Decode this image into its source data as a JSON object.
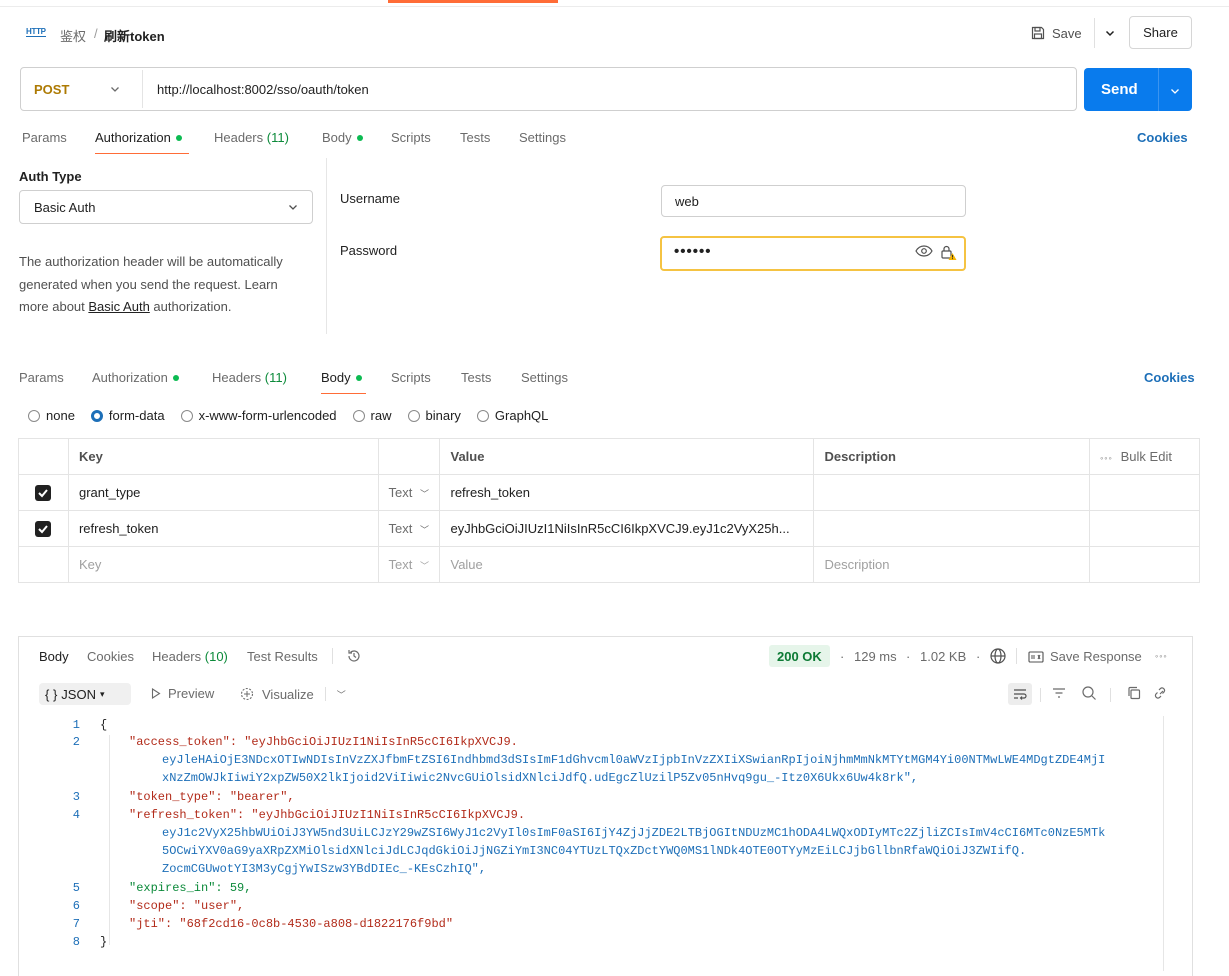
{
  "breadcrumb": {
    "collection": "鉴权",
    "separator": "/",
    "request": "刷新token"
  },
  "header": {
    "save_label": "Save",
    "share_label": "Share",
    "http_badge": "HTTP"
  },
  "request": {
    "method": "POST",
    "url": "http://localhost:8002/sso/oauth/token",
    "send_label": "Send"
  },
  "tabs": {
    "params": "Params",
    "authorization": "Authorization",
    "headers": "Headers",
    "headers_count": "(11)",
    "body": "Body",
    "scripts": "Scripts",
    "tests": "Tests",
    "settings": "Settings",
    "cookies": "Cookies"
  },
  "auth": {
    "type_label": "Auth Type",
    "type_value": "Basic Auth",
    "desc_pre": "The authorization header will be automatically generated when you send the request. Learn more about ",
    "desc_link": "Basic Auth",
    "desc_post": " authorization.",
    "username_label": "Username",
    "username_value": "web",
    "password_label": "Password",
    "password_value": "••••••"
  },
  "body_types": [
    "none",
    "form-data",
    "x-www-form-urlencoded",
    "raw",
    "binary",
    "GraphQL"
  ],
  "body_selected": "form-data",
  "table": {
    "headers": {
      "key": "Key",
      "value": "Value",
      "description": "Description",
      "bulk_edit": "Bulk Edit"
    },
    "rows": [
      {
        "key": "grant_type",
        "type": "Text",
        "value": "refresh_token",
        "description": ""
      },
      {
        "key": "refresh_token",
        "type": "Text",
        "value": "eyJhbGciOiJIUzI1NiIsInR5cCI6IkpXVCJ9.eyJ1c2VyX25h...",
        "description": ""
      }
    ],
    "placeholder": {
      "key": "Key",
      "type": "Text",
      "value": "Value",
      "description": "Description"
    }
  },
  "response": {
    "tabs": [
      "Body",
      "Cookies",
      "Headers",
      "Test Results"
    ],
    "headers_count": "(10)",
    "status": "200 OK",
    "time": "129 ms",
    "size": "1.02 KB",
    "save_response": "Save Response",
    "format": "JSON",
    "preview": "Preview",
    "visualize": "Visualize",
    "lines": [
      "{",
      "\"access_token\": \"eyJhbGciOiJIUzI1NiIsInR5cCI6IkpXVCJ9.",
      "eyJleHAiOjE3NDcxOTIwNDIsInVzZXJfbmFtZSI6Indhbmd3dSIsImF1dGhvcml0aWVzIjpbInVzZXIiXSwianRpIjoiNjhmMmNkMTYtMGM4Yi00NTMwLWE4MDgtZDE4MjI",
      "xNzZmOWJkIiwiY2xpZW50X2lkIjoid2ViIiwic2NvcGUiOlsidXNlciJdfQ.udEgcZlUzilP5Zv05nHvq9gu_-Itz0X6Ukx6Uw4k8rk\",",
      "\"token_type\": \"bearer\",",
      "\"refresh_token\": \"eyJhbGciOiJIUzI1NiIsInR5cCI6IkpXVCJ9.",
      "eyJ1c2VyX25hbWUiOiJ3YW5nd3UiLCJzY29wZSI6WyJ1c2VyIl0sImF0aSI6IjY4ZjJjZDE2LTBjOGItNDUzMC1hODA4LWQxODIyMTc2ZjliZCIsImV4cCI6MTc0NzE5MTk",
      "5OCwiYXV0aG9yaXRpZXMiOlsidXNlciJdLCJqdGkiOiJjNGZiYmI3NC04YTUzLTQxZDctYWQ0MS1lNDk4OTE0OTYyMzEiLCJjbGllbnRfaWQiOiJ3ZWIifQ.",
      "ZocmCGUwotYI3M3yCgjYwISzw3YBdDIEc_-KEsCzhIQ\",",
      "\"expires_in\": 59,",
      "\"scope\": \"user\",",
      "\"jti\": \"68f2cd16-0c8b-4530-a808-d1822176f9bd\"",
      "}"
    ],
    "line_numbers": [
      "1",
      "2",
      "3",
      "4",
      "5",
      "6",
      "7",
      "8"
    ]
  },
  "colors": {
    "accent": "#ff6c37",
    "send": "#097bed",
    "method": "#ad7a03",
    "status_ok": "#0c7a34"
  }
}
